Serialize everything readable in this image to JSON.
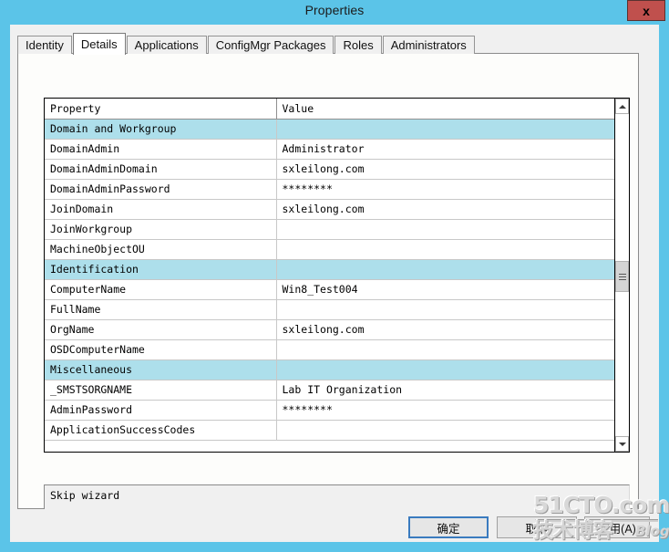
{
  "window": {
    "title": "Properties",
    "close_label": "x",
    "titlebar_color": "#5bc4e8"
  },
  "tabs": [
    {
      "label": "Identity",
      "active": false
    },
    {
      "label": "Details",
      "active": true
    },
    {
      "label": "Applications",
      "active": false
    },
    {
      "label": "ConfigMgr Packages",
      "active": false
    },
    {
      "label": "Roles",
      "active": false
    },
    {
      "label": "Administrators",
      "active": false
    }
  ],
  "grid": {
    "headers": {
      "property": "Property",
      "value": "Value"
    },
    "section_color": "#addfeb",
    "rows": [
      {
        "property": "Domain and Workgroup",
        "value": "",
        "section": true
      },
      {
        "property": "DomainAdmin",
        "value": "Administrator",
        "section": false
      },
      {
        "property": "DomainAdminDomain",
        "value": "sxleilong.com",
        "section": false
      },
      {
        "property": "DomainAdminPassword",
        "value": "********",
        "section": false
      },
      {
        "property": "JoinDomain",
        "value": "sxleilong.com",
        "section": false
      },
      {
        "property": "JoinWorkgroup",
        "value": "",
        "section": false
      },
      {
        "property": "MachineObjectOU",
        "value": "",
        "section": false
      },
      {
        "property": "Identification",
        "value": "",
        "section": true
      },
      {
        "property": "ComputerName",
        "value": "Win8_Test004",
        "section": false
      },
      {
        "property": "FullName",
        "value": "",
        "section": false
      },
      {
        "property": "OrgName",
        "value": "sxleilong.com",
        "section": false
      },
      {
        "property": "OSDComputerName",
        "value": "",
        "section": false
      },
      {
        "property": "Miscellaneous",
        "value": "",
        "section": true
      },
      {
        "property": "_SMSTSORGNAME",
        "value": "Lab IT Organization",
        "section": false
      },
      {
        "property": "AdminPassword",
        "value": "********",
        "section": false
      },
      {
        "property": "ApplicationSuccessCodes",
        "value": "",
        "section": false
      }
    ]
  },
  "description": {
    "text": "Skip wizard"
  },
  "buttons": {
    "ok": "确定",
    "cancel": "取消",
    "apply": "应用(A)"
  },
  "watermark": {
    "top": "51CTO.com",
    "bottom": "技术博客",
    "blog": "Blog"
  }
}
